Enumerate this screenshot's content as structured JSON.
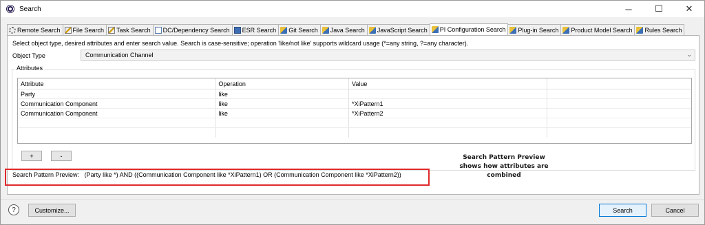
{
  "window": {
    "title": "Search",
    "minimize": "─",
    "maximize": "☐",
    "close": "✕"
  },
  "tabs": [
    {
      "label": "Remote Search",
      "icon": "gear-icon"
    },
    {
      "label": "File Search",
      "icon": "pencil-icon"
    },
    {
      "label": "Task Search",
      "icon": "pencil-icon"
    },
    {
      "label": "DC/Dependency Search",
      "icon": "doc-icon"
    },
    {
      "label": "ESR Search",
      "icon": "esr-icon"
    },
    {
      "label": "Git Search",
      "icon": "flash-icon"
    },
    {
      "label": "Java Search",
      "icon": "flash-icon"
    },
    {
      "label": "JavaScript Search",
      "icon": "flash-icon"
    },
    {
      "label": "PI Configuration Search",
      "icon": "flash-icon",
      "active": true
    },
    {
      "label": "Plug-in Search",
      "icon": "flash-icon"
    },
    {
      "label": "Product Model Search",
      "icon": "flash-icon"
    },
    {
      "label": "Rules Search",
      "icon": "flash-icon"
    }
  ],
  "hint": "Select object type, desired attributes and enter search value. Search is case-sensitive; operation 'like/not like' supports wildcard usage (*=any string, ?=any character).",
  "object_type": {
    "label": "Object Type",
    "value": "Communication Channel"
  },
  "attributes": {
    "group_label": "Attributes",
    "columns": [
      "Attribute",
      "Operation",
      "Value",
      ""
    ],
    "rows": [
      [
        "Party",
        "like",
        "",
        ""
      ],
      [
        "Communication Component",
        "like",
        "*XiPattern1",
        ""
      ],
      [
        "Communication Component",
        "like",
        "*XiPattern2",
        ""
      ]
    ],
    "add_label": "+",
    "remove_label": "-"
  },
  "preview": {
    "label": "Search Pattern Preview:",
    "value": "(Party like *) AND ((Communication Component like *XiPattern1) OR (Communication Component like *XiPattern2))"
  },
  "callout": "Search Pattern Preview shows how attributes are combined",
  "footer": {
    "help": "?",
    "customize": "Customize...",
    "search": "Search",
    "cancel": "Cancel"
  }
}
